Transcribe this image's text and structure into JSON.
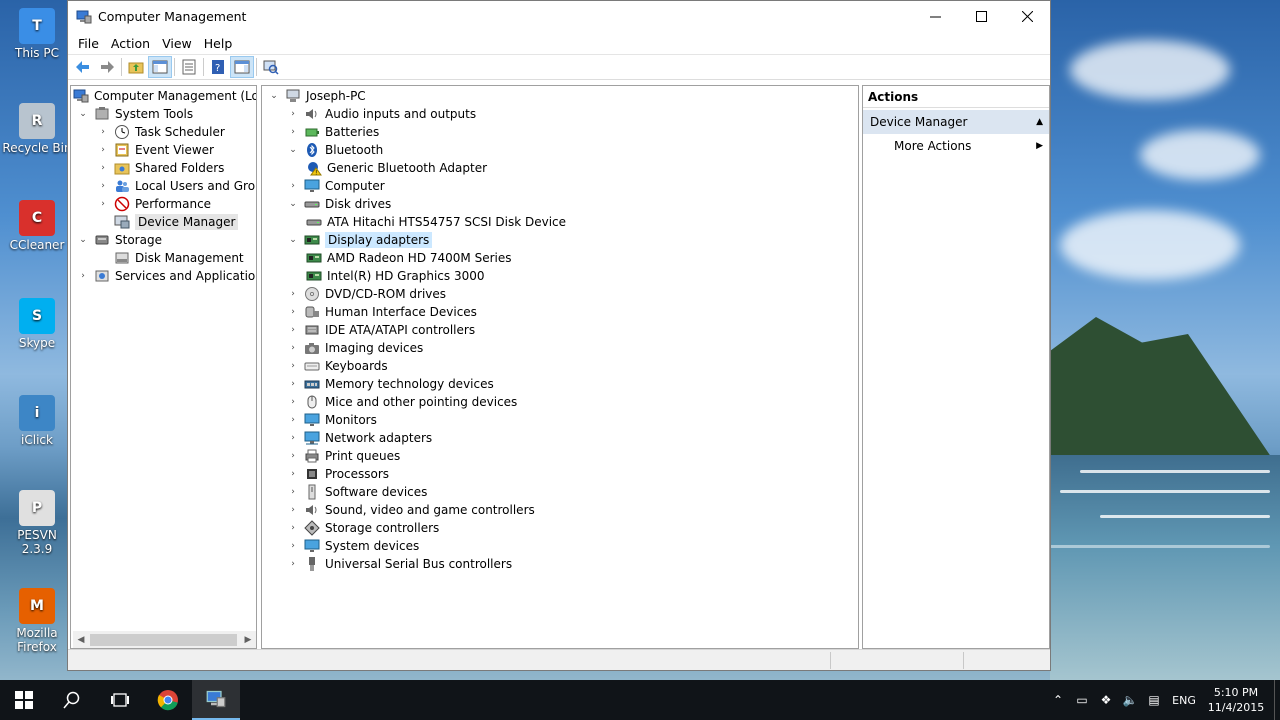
{
  "desktop": {
    "icons": [
      {
        "label": "This PC",
        "icon": "this-pc-icon",
        "color": "#3a8ee6"
      },
      {
        "label": "Recycle Bin",
        "icon": "recycle-bin-icon",
        "color": "#b8c4cf"
      },
      {
        "label": "CCleaner",
        "icon": "ccleaner-icon",
        "color": "#d9302c"
      },
      {
        "label": "Skype",
        "icon": "skype-icon",
        "color": "#00aff0"
      },
      {
        "label": "iClick",
        "icon": "iclick-icon",
        "color": "#3d86c6"
      },
      {
        "label": "PESVN 2.3.9",
        "icon": "pesvn-icon",
        "color": "#e0e0e0"
      },
      {
        "label": "Mozilla Firefox",
        "icon": "firefox-icon",
        "color": "#e66000"
      }
    ]
  },
  "window": {
    "title": "Computer Management",
    "menu": [
      "File",
      "Action",
      "View",
      "Help"
    ]
  },
  "left_tree": {
    "root": "Computer Management (Local",
    "items": [
      {
        "label": "System Tools",
        "icon": "tools-icon",
        "level": 1,
        "expanded": true
      },
      {
        "label": "Task Scheduler",
        "icon": "clock-icon",
        "level": 2
      },
      {
        "label": "Event Viewer",
        "icon": "event-viewer-icon",
        "level": 2
      },
      {
        "label": "Shared Folders",
        "icon": "shared-folder-icon",
        "level": 2
      },
      {
        "label": "Local Users and Groups",
        "icon": "users-icon",
        "level": 2
      },
      {
        "label": "Performance",
        "icon": "performance-icon",
        "level": 2
      },
      {
        "label": "Device Manager",
        "icon": "device-manager-icon",
        "level": 2,
        "selected": true
      },
      {
        "label": "Storage",
        "icon": "storage-icon",
        "level": 1,
        "expanded": true
      },
      {
        "label": "Disk Management",
        "icon": "disk-management-icon",
        "level": 2
      },
      {
        "label": "Services and Applications",
        "icon": "services-icon",
        "level": 1
      }
    ]
  },
  "device_tree": {
    "root": "Joseph-PC",
    "items": [
      {
        "label": "Audio inputs and outputs",
        "icon": "speaker-icon",
        "level": 1,
        "state": "collapsed"
      },
      {
        "label": "Batteries",
        "icon": "battery-icon",
        "level": 1,
        "state": "collapsed"
      },
      {
        "label": "Bluetooth",
        "icon": "bluetooth-icon",
        "level": 1,
        "state": "expanded"
      },
      {
        "label": "Generic Bluetooth Adapter",
        "icon": "warning-device-icon",
        "level": 2
      },
      {
        "label": "Computer",
        "icon": "monitor-icon",
        "level": 1,
        "state": "collapsed"
      },
      {
        "label": "Disk drives",
        "icon": "disk-drive-icon",
        "level": 1,
        "state": "expanded"
      },
      {
        "label": "ATA Hitachi HTS54757 SCSI Disk Device",
        "icon": "disk-drive-icon",
        "level": 2
      },
      {
        "label": "Display adapters",
        "icon": "display-adapter-icon",
        "level": 1,
        "state": "expanded",
        "highlight": true
      },
      {
        "label": "AMD Radeon HD 7400M Series",
        "icon": "display-adapter-icon",
        "level": 2
      },
      {
        "label": "Intel(R) HD Graphics 3000",
        "icon": "display-adapter-icon",
        "level": 2
      },
      {
        "label": "DVD/CD-ROM drives",
        "icon": "dvd-icon",
        "level": 1,
        "state": "collapsed"
      },
      {
        "label": "Human Interface Devices",
        "icon": "hid-icon",
        "level": 1,
        "state": "collapsed"
      },
      {
        "label": "IDE ATA/ATAPI controllers",
        "icon": "ide-controller-icon",
        "level": 1,
        "state": "collapsed"
      },
      {
        "label": "Imaging devices",
        "icon": "camera-icon",
        "level": 1,
        "state": "collapsed"
      },
      {
        "label": "Keyboards",
        "icon": "keyboard-icon",
        "level": 1,
        "state": "collapsed"
      },
      {
        "label": "Memory technology devices",
        "icon": "memory-icon",
        "level": 1,
        "state": "collapsed"
      },
      {
        "label": "Mice and other pointing devices",
        "icon": "mouse-icon",
        "level": 1,
        "state": "collapsed"
      },
      {
        "label": "Monitors",
        "icon": "monitor-icon",
        "level": 1,
        "state": "collapsed"
      },
      {
        "label": "Network adapters",
        "icon": "network-adapter-icon",
        "level": 1,
        "state": "collapsed"
      },
      {
        "label": "Print queues",
        "icon": "printer-icon",
        "level": 1,
        "state": "collapsed"
      },
      {
        "label": "Processors",
        "icon": "processor-icon",
        "level": 1,
        "state": "collapsed"
      },
      {
        "label": "Software devices",
        "icon": "software-device-icon",
        "level": 1,
        "state": "collapsed"
      },
      {
        "label": "Sound, video and game controllers",
        "icon": "speaker-icon",
        "level": 1,
        "state": "collapsed"
      },
      {
        "label": "Storage controllers",
        "icon": "storage-controller-icon",
        "level": 1,
        "state": "collapsed"
      },
      {
        "label": "System devices",
        "icon": "monitor-icon",
        "level": 1,
        "state": "collapsed"
      },
      {
        "label": "Universal Serial Bus controllers",
        "icon": "usb-icon",
        "level": 1,
        "state": "collapsed"
      }
    ]
  },
  "actions_pane": {
    "header": "Actions",
    "section": "Device Manager",
    "item": "More Actions"
  },
  "taskbar": {
    "language": "ENG",
    "time": "5:10 PM",
    "date": "11/4/2015"
  },
  "colors": {
    "selection": "#e5e5e5",
    "highlight": "#cce8ff",
    "actions_section": "#dbe5f1",
    "taskbar": "#101418"
  }
}
